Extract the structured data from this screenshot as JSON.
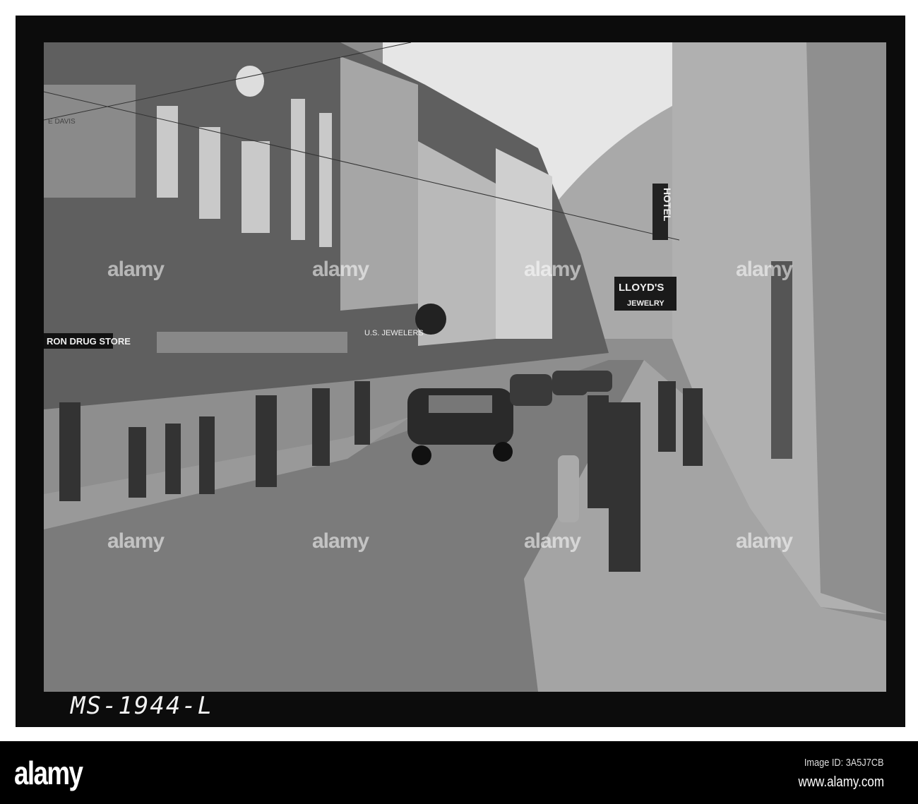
{
  "photo": {
    "negative_label": "MS-1944-L",
    "signs": {
      "drug_store": "RON DRUG STORE",
      "lloyds": "LLOYD'S",
      "jewelry": "JEWELRY",
      "hotel": "HOTEL",
      "us_jewelers": "U.S. JEWELERS",
      "davis": "E DAVIS"
    }
  },
  "watermark": "alamy",
  "footer": {
    "logo": "alamy",
    "image_id": "Image ID: 3A5J7CB",
    "website": "www.alamy.com"
  }
}
